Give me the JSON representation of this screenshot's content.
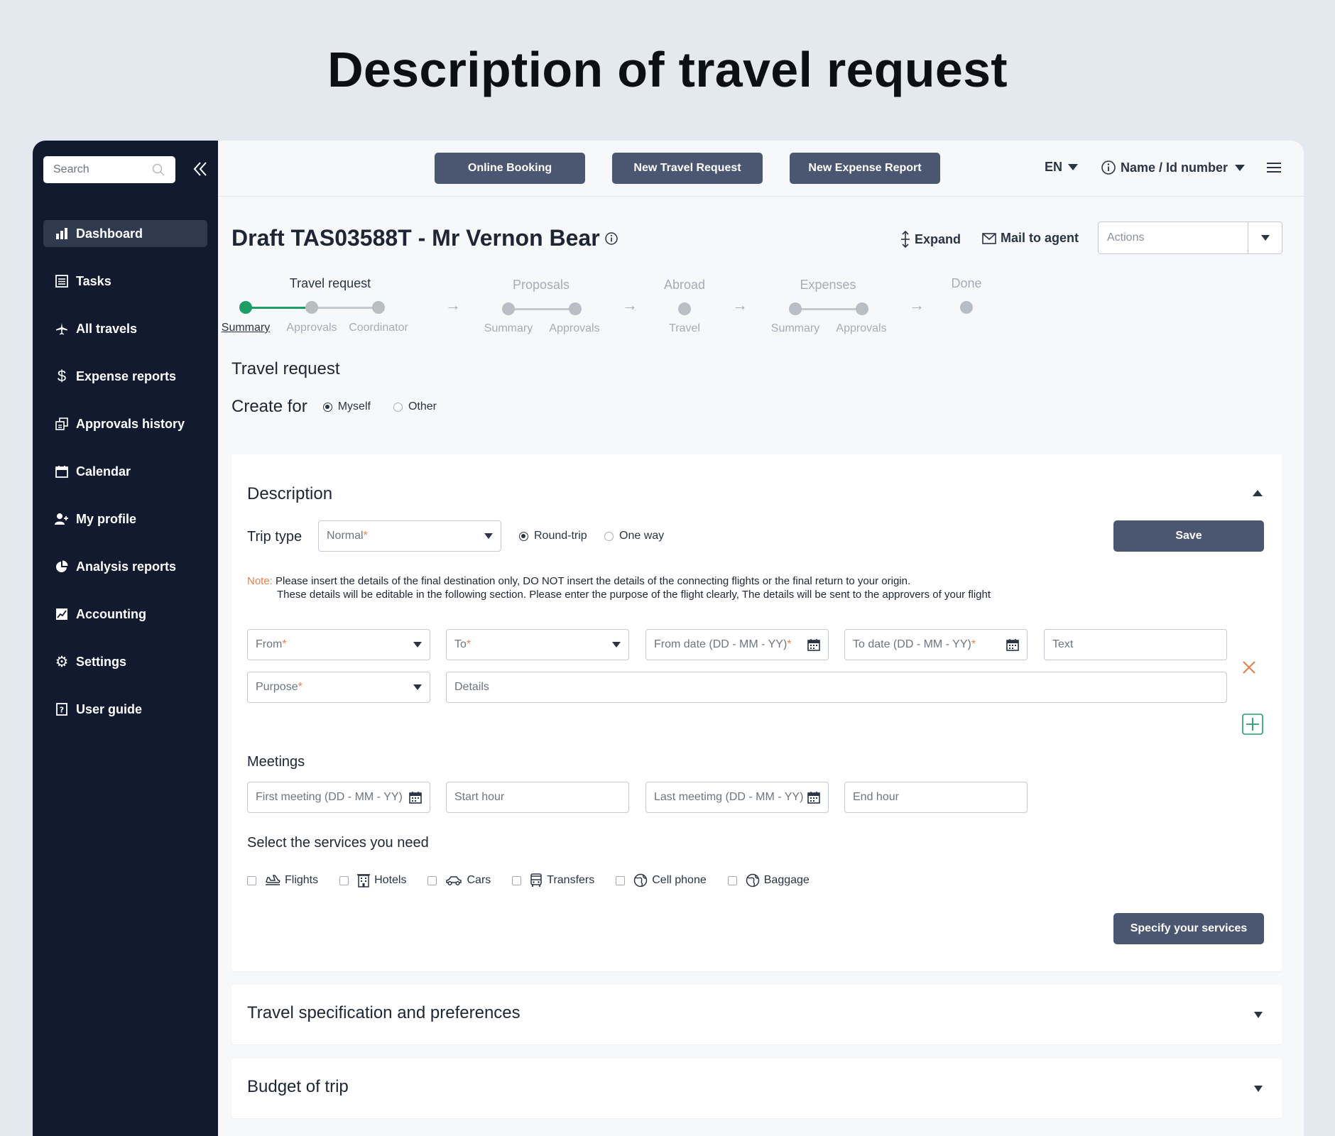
{
  "page_heading": "Description of travel request",
  "sidebar": {
    "search_placeholder": "Search",
    "items": [
      {
        "label": "Dashboard",
        "icon": "bar-chart-icon",
        "active": true
      },
      {
        "label": "Tasks",
        "icon": "list-icon"
      },
      {
        "label": "All travels",
        "icon": "airplane-icon"
      },
      {
        "label": "Expense reports",
        "icon": "dollar-icon"
      },
      {
        "label": "Approvals history",
        "icon": "approvals-icon"
      },
      {
        "label": "Calendar",
        "icon": "calendar-icon"
      },
      {
        "label": "My profile",
        "icon": "user-add-icon"
      },
      {
        "label": "Analysis reports",
        "icon": "pie-chart-icon"
      },
      {
        "label": "Accounting",
        "icon": "accounting-icon"
      },
      {
        "label": "Settings",
        "icon": "gear-icon"
      },
      {
        "label": "User guide",
        "icon": "help-icon"
      }
    ]
  },
  "topbar": {
    "online_booking": "Online Booking",
    "new_travel_request": "New Travel Request",
    "new_expense_report": "New Expense Report",
    "language": "EN",
    "user": "Name / Id number"
  },
  "header": {
    "title": "Draft TAS03588T - Mr Vernon Bear",
    "expand": "Expand",
    "mail_to_agent": "Mail to agent",
    "actions_placeholder": "Actions"
  },
  "stepper": {
    "travel_request": {
      "title": "Travel request",
      "steps": [
        "Summary",
        "Approvals",
        "Coordinator"
      ]
    },
    "proposals": {
      "title": "Proposals",
      "steps": [
        "Summary",
        "Approvals"
      ]
    },
    "abroad": {
      "title": "Abroad",
      "steps": [
        "Travel"
      ]
    },
    "expenses": {
      "title": "Expenses",
      "steps": [
        "Summary",
        "Approvals"
      ]
    },
    "done": {
      "title": "Done"
    }
  },
  "section": {
    "title": "Travel request",
    "create_for_label": "Create for",
    "create_for_options": [
      "Myself",
      "Other"
    ],
    "create_for_selected": "Myself"
  },
  "description": {
    "title": "Description",
    "trip_type_label": "Trip type",
    "trip_type_value": "Normal",
    "trip_options": [
      "Round-trip",
      "One way"
    ],
    "trip_selected": "Round-trip",
    "save": "Save",
    "note_label": "Note:",
    "note_line1": "Please insert the details of the final destination only, DO NOT insert the details of the connecting flights or the final return to your origin.",
    "note_line2": "These details will be editable in the following section. Please enter the purpose of the flight clearly, The details will be sent to the approvers of your flight",
    "from": "From",
    "to": "To",
    "from_date": "From date (DD - MM - YY)",
    "to_date": "To date (DD - MM - YY)",
    "text": "Text",
    "purpose": "Purpose",
    "details": "Details",
    "required_mark": "*",
    "meetings_label": "Meetings",
    "first_meeting": "First meeting (DD - MM - YY)",
    "start_hour": "Start hour",
    "last_meeting": "Last meetimg (DD - MM - YY)",
    "end_hour": "End hour",
    "services_label": "Select the services you need",
    "services": [
      "Flights",
      "Hotels",
      "Cars",
      "Transfers",
      "Cell phone",
      "Baggage"
    ],
    "specify_services": "Specify your services"
  },
  "collapsed_sections": [
    "Travel specification and preferences",
    "Budget of trip"
  ],
  "colors": {
    "sidebar": "#111a2e",
    "button": "#4b5670",
    "accent_green": "#1f9d67",
    "required": "#e4804a"
  }
}
